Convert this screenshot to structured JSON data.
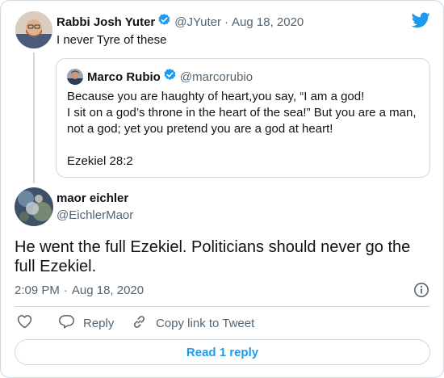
{
  "original_tweet": {
    "author_name": "Rabbi Josh Yuter",
    "handle": "@JYuter",
    "separator": "·",
    "date": "Aug 18, 2020",
    "text": "I never Tyre of these"
  },
  "quoted_tweet": {
    "author_name": "Marco Rubio",
    "handle": "@marcorubio",
    "lines": [
      "Because you are haughty of heart,you say, “I am a god!",
      "I sit on a god’s throne in the heart of the sea!” But you are a man,",
      "not a god; yet you pretend you are a god at heart!"
    ],
    "citation": "Ezekiel 28:2"
  },
  "reply_tweet": {
    "author_name": "maor eichler",
    "handle": "@EichlerMaor",
    "text_lines": [
      "He went the full Ezekiel. Politicians should never go the",
      "full Ezekiel."
    ],
    "time": "2:09 PM",
    "separator": "·",
    "date": "Aug 18, 2020"
  },
  "actions": {
    "reply_label": "Reply",
    "copy_link_label": "Copy link to Tweet"
  },
  "read_replies_label": "Read 1 reply",
  "icons": {
    "brand": "twitter-bird-icon",
    "verified": "verified-badge-icon",
    "info": "info-icon",
    "like": "heart-icon",
    "reply": "reply-bubble-icon",
    "copy_link": "link-icon"
  },
  "colors": {
    "accent": "#1d9bf0",
    "text": "#0f1419",
    "muted": "#536471",
    "border": "#cfd9de"
  }
}
